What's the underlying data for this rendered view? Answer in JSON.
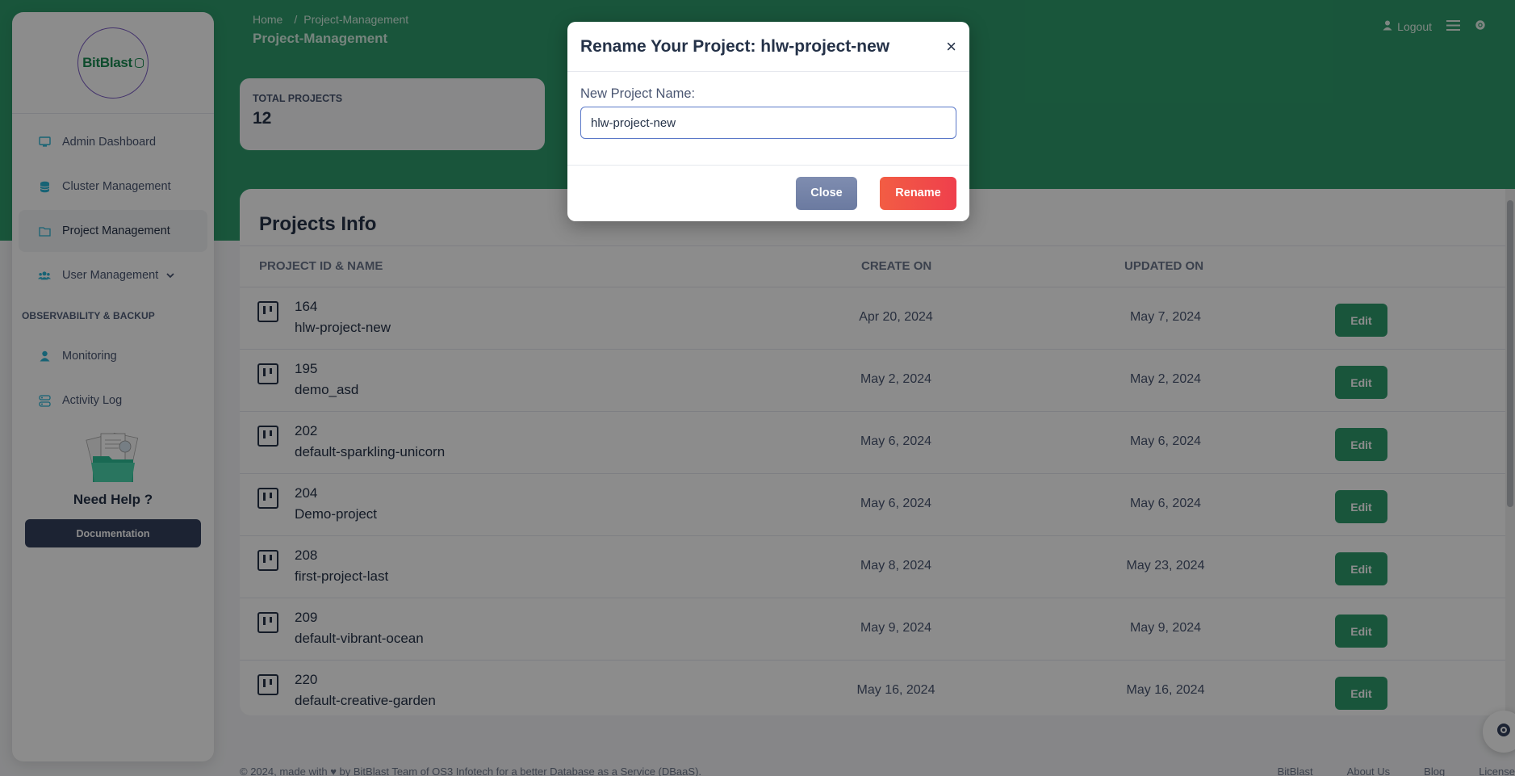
{
  "brand": {
    "logo_text": "BitBlast"
  },
  "sidebar": {
    "items": [
      {
        "label": "Admin Dashboard",
        "icon": "monitor-icon"
      },
      {
        "label": "Cluster Management",
        "icon": "database-icon"
      },
      {
        "label": "Project Management",
        "icon": "folder-icon",
        "active": true
      },
      {
        "label": "User Management",
        "icon": "users-icon"
      }
    ],
    "section_label": "OBSERVABILITY & BACKUP",
    "section_items": [
      {
        "label": "Monitoring",
        "icon": "user-icon"
      },
      {
        "label": "Activity Log",
        "icon": "activity-icon"
      }
    ],
    "help_title": "Need Help ?",
    "doc_button": "Documentation"
  },
  "header": {
    "breadcrumb_home": "Home",
    "breadcrumb_sep": "/",
    "breadcrumb_current": "Project-Management",
    "page_title": "Project-Management",
    "logout_label": "Logout"
  },
  "stats": {
    "label": "TOTAL PROJECTS",
    "value": "12"
  },
  "projects": {
    "title": "Projects Info",
    "columns": [
      "PROJECT ID & NAME",
      "CREATE ON",
      "UPDATED ON"
    ],
    "edit_label": "Edit",
    "rows": [
      {
        "id": "164",
        "name": "hlw-project-new",
        "created": "Apr 20, 2024",
        "updated": "May 7, 2024"
      },
      {
        "id": "195",
        "name": "demo_asd",
        "created": "May 2, 2024",
        "updated": "May 2, 2024"
      },
      {
        "id": "202",
        "name": "default-sparkling-unicorn",
        "created": "May 6, 2024",
        "updated": "May 6, 2024"
      },
      {
        "id": "204",
        "name": "Demo-project",
        "created": "May 6, 2024",
        "updated": "May 6, 2024"
      },
      {
        "id": "208",
        "name": "first-project-last",
        "created": "May 8, 2024",
        "updated": "May 23, 2024"
      },
      {
        "id": "209",
        "name": "default-vibrant-ocean",
        "created": "May 9, 2024",
        "updated": "May 9, 2024"
      },
      {
        "id": "220",
        "name": "default-creative-garden",
        "created": "May 16, 2024",
        "updated": "May 16, 2024"
      }
    ]
  },
  "footer": {
    "text": "© 2024, made with ♥ by BitBlast Team of OS3 Infotech for a better Database as a Service (DBaaS).",
    "links": [
      "BitBlast",
      "About Us",
      "Blog",
      "License"
    ]
  },
  "modal": {
    "title": "Rename Your Project: hlw-project-new",
    "close_symbol": "×",
    "field_label": "New Project Name:",
    "field_value": "hlw-project-new",
    "close_button": "Close",
    "rename_button": "Rename"
  },
  "colors": {
    "brand_green": "#2e9c6c",
    "rename_red": "#ef3f4c",
    "dark_navy": "#34405e"
  }
}
